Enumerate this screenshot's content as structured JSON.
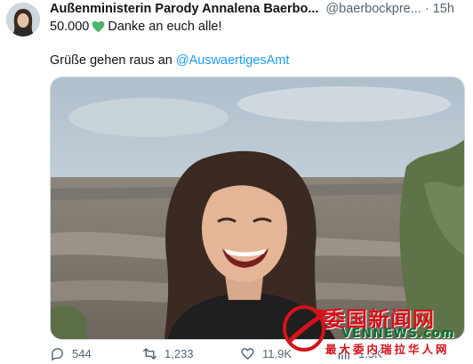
{
  "author": {
    "display_name": "Außenministerin Parody Annalena Baerbo...",
    "handle": "@baerbockpre...",
    "separator": "·",
    "time": "15h"
  },
  "text": {
    "line1_before": "50.000",
    "line1_after": "Danke an euch alle!",
    "line2_before": "Grüße gehen raus an ",
    "mention": "@AuswaertigesAmt"
  },
  "icons": {
    "heart": "green-heart-emoji",
    "reply": "reply-icon",
    "retweet": "retweet-icon",
    "like": "like-icon",
    "views": "views-icon"
  },
  "actions": {
    "replies": "544",
    "retweets": "1,233",
    "likes": "11.9K",
    "views": "1.5K"
  },
  "watermark": {
    "title": "委国新闻网",
    "url": "VENNEWS.com",
    "subtitle": "最大委内瑞拉华人网"
  },
  "colors": {
    "accent": "#1d9bf0",
    "heart": "#4fb66b",
    "watermark_red": "#d5121a",
    "watermark_green": "#0a6e2e"
  }
}
